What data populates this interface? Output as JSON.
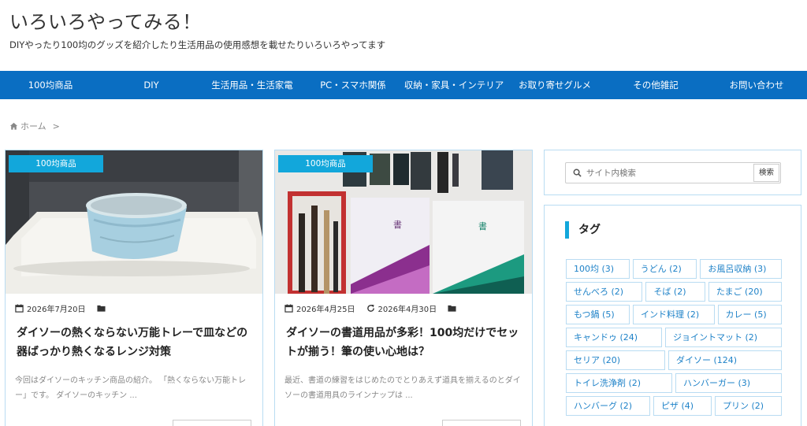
{
  "site": {
    "title": "いろいろやってみる！",
    "description": "DIYやったり100均のグッズを紹介したり生活用品の使用感想を載せたりいろいろやってます"
  },
  "nav": [
    "100均商品",
    "DIY",
    "生活用品・生活家電",
    "PC・スマホ関係",
    "収納・家具・インテリア",
    "お取り寄せグルメ",
    "その他雑記",
    "お問い合わせ"
  ],
  "breadcrumb": {
    "home": "ホーム",
    "separator": ">"
  },
  "posts": [
    {
      "category": "100均商品",
      "date": "2026年7月20日",
      "updated": "",
      "title": "ダイソーの熱くならない万能トレーで皿などの器ばっかり熱くなるレンジ対策",
      "excerpt": "今回はダイソーのキッチン商品の紹介。 「熱くならない万能トレー」です。 ダイソーのキッチン ..."
    },
    {
      "category": "100均商品",
      "date": "2026年4月25日",
      "updated": "2026年4月30日",
      "title": "ダイソーの書道用品が多彩！100均だけでセットが揃う！筆の使い心地は？",
      "excerpt": "最近、書道の練習をはじめたのでとりあえず道具を揃えるのとダイソーの書道用具のラインナップは ..."
    }
  ],
  "search": {
    "placeholder": "サイト内検索",
    "button": "検索"
  },
  "tags": {
    "heading": "タグ",
    "items": [
      "100均 (3)",
      "うどん (2)",
      "お風呂収納 (3)",
      "せんべろ (2)",
      "そば (2)",
      "たまご (20)",
      "もつ鍋 (5)",
      "インド料理 (2)",
      "カレー (5)",
      "キャンドゥ (24)",
      "ジョイントマット (2)",
      "セリア (20)",
      "ダイソー (124)",
      "トイレ洗浄剤 (2)",
      "ハンバーガー (3)",
      "ハンバーグ (2)",
      "ピザ (4)",
      "プリン (2)"
    ]
  },
  "colors": {
    "nav_bg": "#0a6ec2",
    "accent": "#12a7db",
    "tag_text": "#1e82c8",
    "border": "#b9dcf2"
  },
  "icons": {
    "home": "home-icon",
    "calendar": "calendar-icon",
    "refresh": "refresh-icon",
    "folder": "folder-icon",
    "search": "search-icon"
  }
}
